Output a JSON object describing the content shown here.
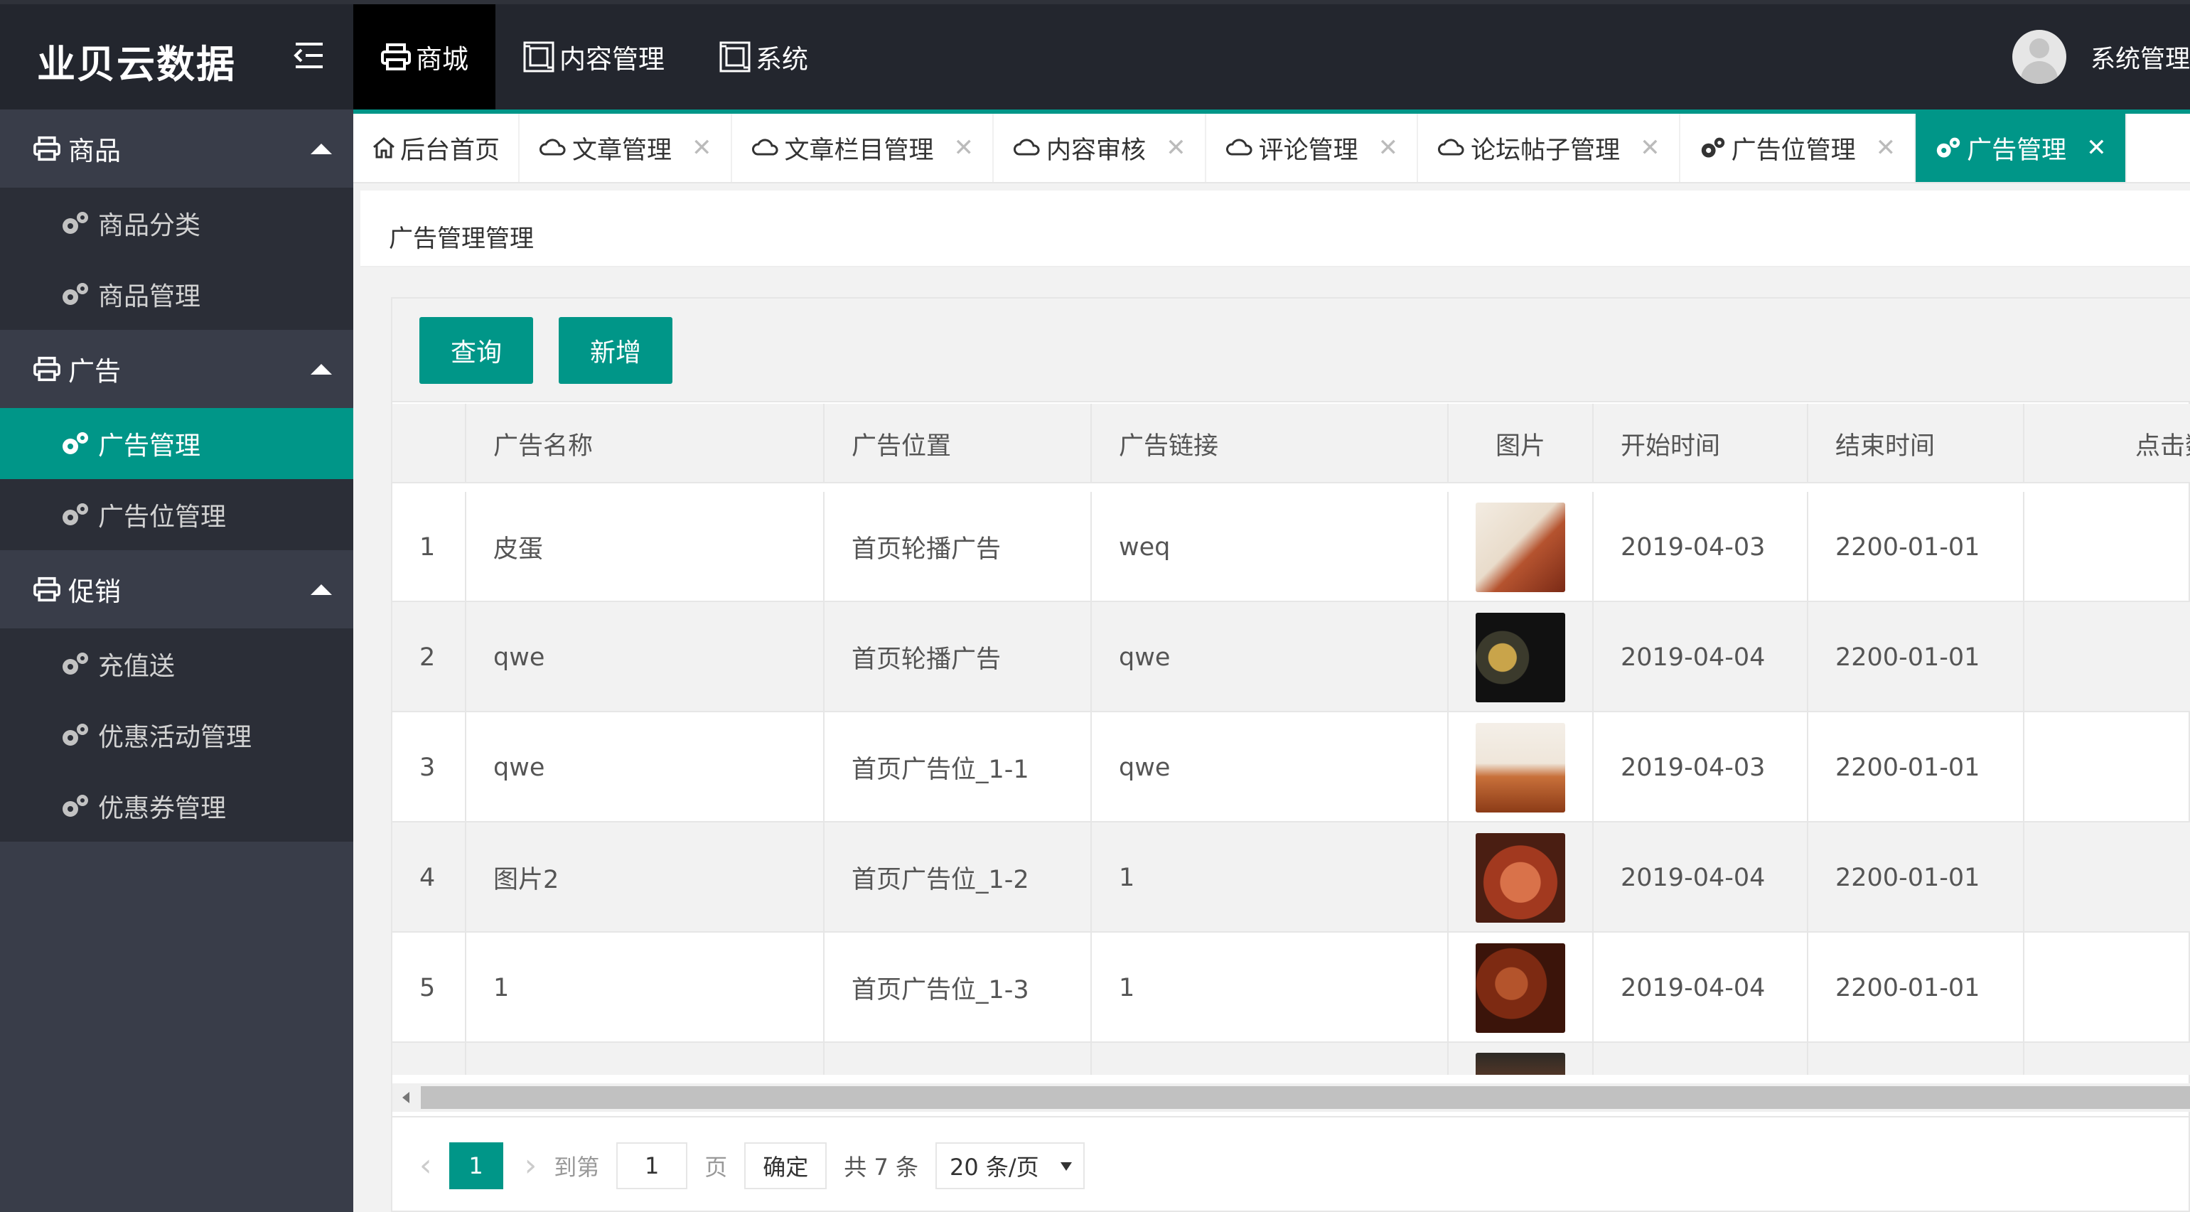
{
  "header": {
    "logo": "业贝云数据",
    "nav": [
      {
        "label": "商城",
        "icon": "printer-icon"
      },
      {
        "label": "内容管理",
        "icon": "layout-icon"
      },
      {
        "label": "系统",
        "icon": "layout-icon"
      }
    ],
    "user_name": "系统管理"
  },
  "sidebar": {
    "groups": [
      {
        "label": "商品",
        "icon": "printer-icon",
        "items": [
          {
            "label": "商品分类"
          },
          {
            "label": "商品管理"
          }
        ]
      },
      {
        "label": "广告",
        "icon": "printer-icon",
        "items": [
          {
            "label": "广告管理"
          },
          {
            "label": "广告位管理"
          }
        ]
      },
      {
        "label": "促销",
        "icon": "printer-icon",
        "items": [
          {
            "label": "充值送"
          },
          {
            "label": "优惠活动管理"
          },
          {
            "label": "优惠券管理"
          }
        ]
      }
    ],
    "active_item": "广告管理"
  },
  "tabs": [
    {
      "label": "后台首页",
      "icon": "home-icon",
      "closable": false
    },
    {
      "label": "文章管理",
      "icon": "cloud-icon",
      "closable": true
    },
    {
      "label": "文章栏目管理",
      "icon": "cloud-icon",
      "closable": true
    },
    {
      "label": "内容审核",
      "icon": "cloud-icon",
      "closable": true
    },
    {
      "label": "评论管理",
      "icon": "cloud-icon",
      "closable": true
    },
    {
      "label": "论坛帖子管理",
      "icon": "cloud-icon",
      "closable": true
    },
    {
      "label": "广告位管理",
      "icon": "gear-icon",
      "closable": true
    },
    {
      "label": "广告管理",
      "icon": "gear-icon",
      "closable": true,
      "active": true
    }
  ],
  "breadcrumb": "广告管理管理",
  "toolbar": {
    "query_label": "查询",
    "add_label": "新增"
  },
  "table": {
    "columns": [
      "",
      "广告名称",
      "广告位置",
      "广告链接",
      "图片",
      "开始时间",
      "结束时间",
      "点击数"
    ],
    "rows": [
      {
        "no": "1",
        "name": "皮蛋",
        "position": "首页轮播广告",
        "link": "weq",
        "start": "2019-04-03",
        "end": "2200-01-01"
      },
      {
        "no": "2",
        "name": "qwe",
        "position": "首页轮播广告",
        "link": "qwe",
        "start": "2019-04-04",
        "end": "2200-01-01"
      },
      {
        "no": "3",
        "name": "qwe",
        "position": "首页广告位_1-1",
        "link": "qwe",
        "start": "2019-04-03",
        "end": "2200-01-01"
      },
      {
        "no": "4",
        "name": "图片2",
        "position": "首页广告位_1-2",
        "link": "1",
        "start": "2019-04-04",
        "end": "2200-01-01"
      },
      {
        "no": "5",
        "name": "1",
        "position": "首页广告位_1-3",
        "link": "1",
        "start": "2019-04-04",
        "end": "2200-01-01"
      },
      {
        "no": "",
        "name": "",
        "position": "",
        "link": "",
        "start": "",
        "end": ""
      }
    ]
  },
  "pagination": {
    "current": "1",
    "goto_label": "到第",
    "page_input": "1",
    "page_label": "页",
    "confirm_label": "确定",
    "total_text": "共 7 条",
    "page_size": "20 条/页"
  },
  "colors": {
    "accent": "#009688",
    "header_bg": "#23262e",
    "sidebar_bg": "#393d49"
  }
}
